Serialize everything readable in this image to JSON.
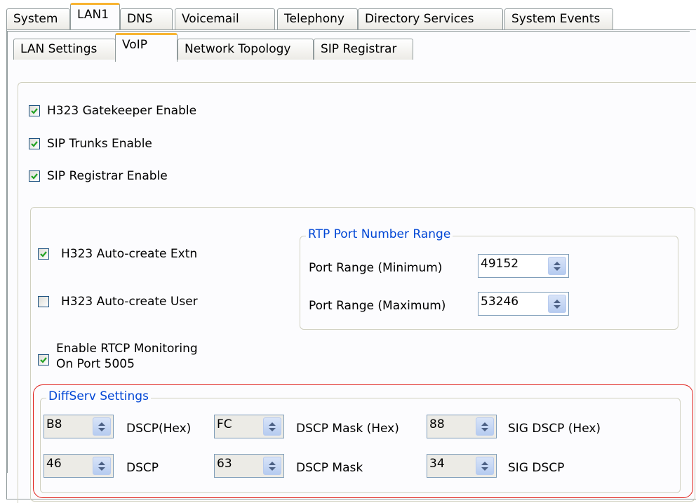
{
  "top_tabs": [
    {
      "label": "System",
      "active": false
    },
    {
      "label": "LAN1",
      "active": true
    },
    {
      "label": "DNS",
      "active": false
    },
    {
      "label": "Voicemail",
      "active": false
    },
    {
      "label": "Telephony",
      "active": false
    },
    {
      "label": "Directory Services",
      "active": false
    },
    {
      "label": "System Events",
      "active": false
    }
  ],
  "sub_tabs": [
    {
      "label": "LAN Settings",
      "active": false
    },
    {
      "label": "VoIP",
      "active": true
    },
    {
      "label": "Network Topology",
      "active": false
    },
    {
      "label": "SIP Registrar",
      "active": false
    }
  ],
  "checkboxes": {
    "h323_gatekeeper": {
      "label": "H323 Gatekeeper Enable",
      "checked": true
    },
    "sip_trunks": {
      "label": "SIP Trunks Enable",
      "checked": true
    },
    "sip_registrar": {
      "label": "SIP Registrar Enable",
      "checked": true
    },
    "h323_auto_extn": {
      "label": "H323 Auto-create Extn",
      "checked": true
    },
    "h323_auto_user": {
      "label": "H323 Auto-create User",
      "checked": false
    },
    "rtcp_monitoring": {
      "label_line1": "Enable RTCP Monitoring",
      "label_line2": "On Port 5005",
      "checked": true
    }
  },
  "rtp": {
    "legend": "RTP Port Number Range",
    "min_label": "Port Range (Minimum)",
    "min_value": "49152",
    "max_label": "Port Range (Maximum)",
    "max_value": "53246"
  },
  "diffserv": {
    "legend": "DiffServ Settings",
    "dscp_hex": {
      "value": "B8",
      "label": "DSCP(Hex)"
    },
    "dscp_mask_hex": {
      "value": "FC",
      "label": "DSCP Mask (Hex)"
    },
    "sig_dscp_hex": {
      "value": "88",
      "label": "SIG DSCP (Hex)"
    },
    "dscp": {
      "value": "46",
      "label": "DSCP"
    },
    "dscp_mask": {
      "value": "63",
      "label": "DSCP Mask"
    },
    "sig_dscp": {
      "value": "34",
      "label": "SIG DSCP"
    }
  },
  "colors": {
    "accent_tab": "#f8b432",
    "legend_text": "#0046d5",
    "highlight_outline": "#e0201a",
    "checkmark": "#21a121"
  }
}
